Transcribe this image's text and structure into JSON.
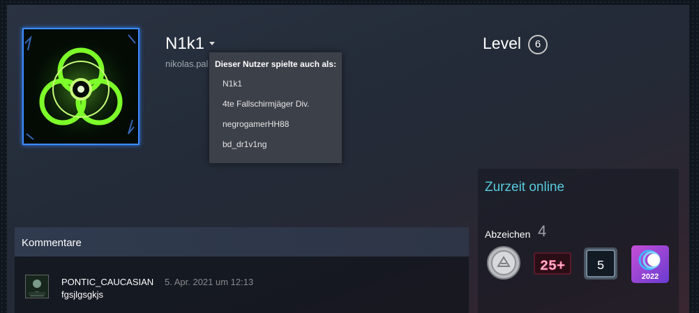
{
  "profile": {
    "persona_name": "N1k1",
    "real_name": "nikolas.pal",
    "avatar_icon": "biohazard-icon"
  },
  "alias_popup": {
    "title": "Dieser Nutzer spielte auch als:",
    "aliases": [
      "N1k1",
      "4te Fallschirmjäger Div.",
      "negrogamerHH88",
      "bd_dr1v1ng"
    ]
  },
  "level": {
    "label": "Level",
    "value": "6"
  },
  "status": {
    "text": "Zurzeit online",
    "color": "#57cbde"
  },
  "badges": {
    "label": "Abzeichen",
    "count": "4",
    "items": [
      {
        "name": "service-coin-badge",
        "text": ""
      },
      {
        "name": "games-25-badge",
        "text": "25+"
      },
      {
        "name": "years-badge",
        "text": "5"
      },
      {
        "name": "steam-replay-2022-badge",
        "text": "2022"
      }
    ]
  },
  "comments": {
    "title": "Kommentare",
    "items": [
      {
        "author": "PONTIC_CAUCASIAN",
        "timestamp": "5. Apr. 2021 um 12:13",
        "text": "fgsjlgsgkjs"
      }
    ]
  }
}
